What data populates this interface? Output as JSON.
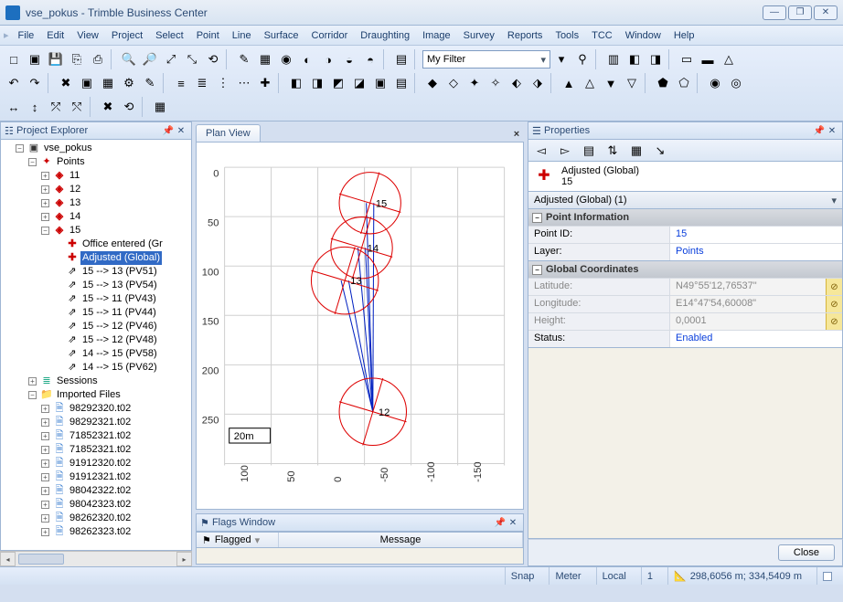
{
  "window": {
    "title": "vse_pokus - Trimble Business Center"
  },
  "menu": [
    "File",
    "Edit",
    "View",
    "Project",
    "Select",
    "Point",
    "Line",
    "Surface",
    "Corridor",
    "Draughting",
    "Image",
    "Survey",
    "Reports",
    "Tools",
    "TCC",
    "Window",
    "Help"
  ],
  "toolbar": {
    "filter_value": "My Filter"
  },
  "explorer": {
    "title": "Project Explorer",
    "root": "vse_pokus",
    "points_label": "Points",
    "point_ids": [
      "11",
      "12",
      "13",
      "14",
      "15"
    ],
    "p15_children": [
      {
        "label": "Office entered (Gr",
        "icon": "pt"
      },
      {
        "label": "Adjusted (Global)",
        "icon": "pt",
        "selected": true
      },
      {
        "label": "15 --> 13 (PV51)",
        "icon": "vec"
      },
      {
        "label": "15 --> 13 (PV54)",
        "icon": "vec"
      },
      {
        "label": "15 --> 11 (PV43)",
        "icon": "vec"
      },
      {
        "label": "15 --> 11 (PV44)",
        "icon": "vec"
      },
      {
        "label": "15 --> 12 (PV46)",
        "icon": "vec"
      },
      {
        "label": "15 --> 12 (PV48)",
        "icon": "vec"
      },
      {
        "label": "14 --> 15 (PV58)",
        "icon": "vec"
      },
      {
        "label": "14 --> 15 (PV62)",
        "icon": "vec"
      }
    ],
    "sessions_label": "Sessions",
    "imported_label": "Imported Files",
    "imported_files": [
      "98292320.t02",
      "98292321.t02",
      "71852321.t02",
      "71852321.t02",
      "91912320.t02",
      "91912321.t02",
      "98042322.t02",
      "98042323.t02",
      "98262320.t02",
      "98262323.t02"
    ]
  },
  "plan": {
    "tab": "Plan View",
    "scale_label": "20m",
    "y_ticks": [
      "0",
      "50",
      "100",
      "150",
      "200",
      "250"
    ],
    "x_ticks": [
      "100",
      "50",
      "0",
      "-50",
      "-100",
      "-150"
    ],
    "points": [
      {
        "id": "15",
        "x": 0.52,
        "y": 0.12,
        "r": 0.11
      },
      {
        "id": "14",
        "x": 0.49,
        "y": 0.27,
        "r": 0.11
      },
      {
        "id": "13",
        "x": 0.43,
        "y": 0.38,
        "r": 0.12
      },
      {
        "id": "12",
        "x": 0.53,
        "y": 0.82,
        "r": 0.12
      }
    ]
  },
  "flags": {
    "title": "Flags Window",
    "col_flagged": "Flagged",
    "col_message": "Message"
  },
  "properties": {
    "title": "Properties",
    "head_name": "Adjusted (Global)",
    "head_id": "15",
    "selector": "Adjusted (Global) (1)",
    "group_info": "Point Information",
    "k_pointid": "Point ID:",
    "v_pointid": "15",
    "k_layer": "Layer:",
    "v_layer": "Points",
    "group_coords": "Global Coordinates",
    "k_lat": "Latitude:",
    "v_lat": "N49°55'12,76537\"",
    "k_lon": "Longitude:",
    "v_lon": "E14°47'54,60008\"",
    "k_h": "Height:",
    "v_h": "0,0001",
    "k_status": "Status:",
    "v_status": "Enabled",
    "close_btn": "Close"
  },
  "status": {
    "snap": "Snap",
    "meter": "Meter",
    "local": "Local",
    "one": "1",
    "coords": "298,6056 m; 334,5409 m"
  }
}
